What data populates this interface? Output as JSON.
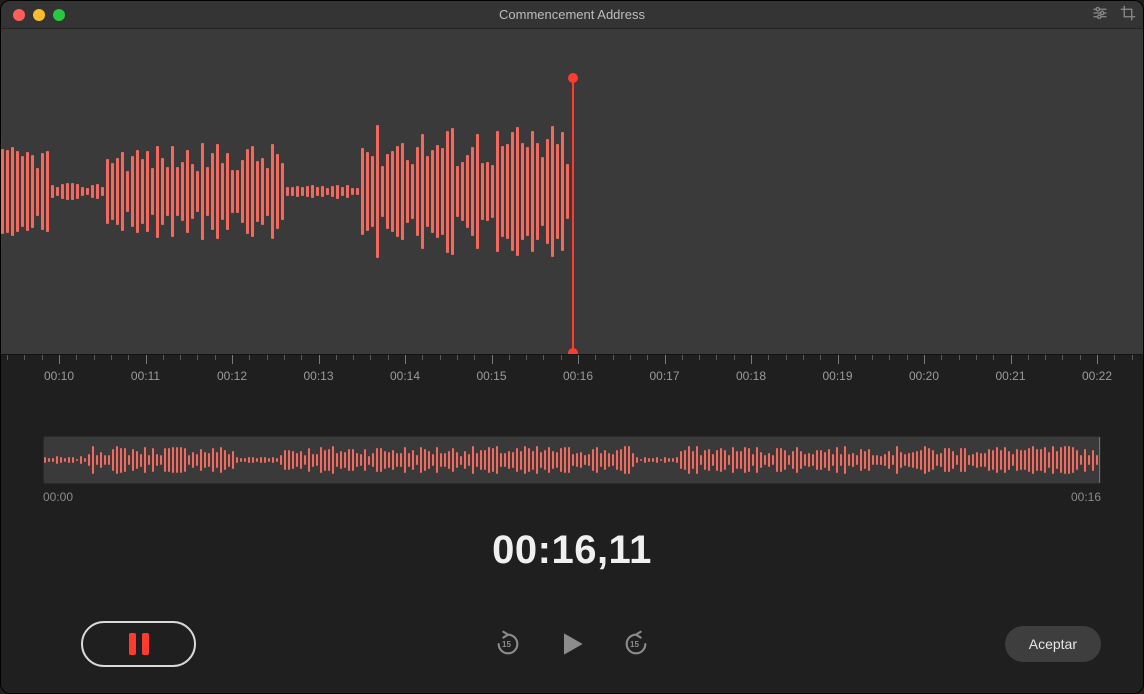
{
  "window": {
    "title": "Commencement Address"
  },
  "timeline": {
    "labels": [
      "00:10",
      "00:11",
      "00:12",
      "00:13",
      "00:14",
      "00:15",
      "00:16",
      "00:17",
      "00:18",
      "00:19",
      "00:20",
      "00:21",
      "00:22"
    ],
    "playhead_seconds": 16
  },
  "overview": {
    "start_label": "00:00",
    "end_label": "00:16"
  },
  "time_readout": "00:16,11",
  "controls": {
    "skip_amount": "15",
    "done_label": "Aceptar"
  },
  "colors": {
    "accent": "#ff3b30",
    "waveform": "#f4695e"
  }
}
